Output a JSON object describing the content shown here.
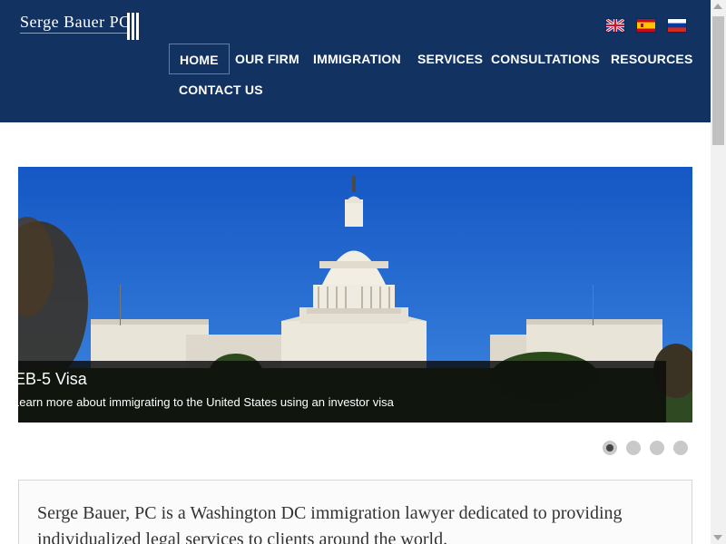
{
  "brand": {
    "name": "Serge Bauer",
    "suffix": "PC"
  },
  "languages": [
    {
      "icon": "uk-flag-icon"
    },
    {
      "icon": "spain-flag-icon"
    },
    {
      "icon": "russia-flag-icon"
    }
  ],
  "nav": {
    "items": [
      {
        "label": "HOME",
        "active": true
      },
      {
        "label": "OUR FIRM"
      },
      {
        "label": "IMMIGRATION"
      },
      {
        "label": "SERVICES"
      },
      {
        "label": "CONSULTATIONS"
      },
      {
        "label": "RESOURCES"
      },
      {
        "label": "CONTACT US"
      }
    ]
  },
  "slider": {
    "caption_title": "EB-5 Visa",
    "caption_text": "Learn more about immigrating to the United States using an investor visa",
    "slide_count": 4,
    "active_slide": 1
  },
  "intro": {
    "text": "Serge Bauer, PC is a Washington DC immigration lawyer dedicated to providing individualized legal services to clients around the world."
  },
  "colors": {
    "header": "#123361",
    "caption_bg": "#0a0a0a",
    "text": "#333333"
  }
}
